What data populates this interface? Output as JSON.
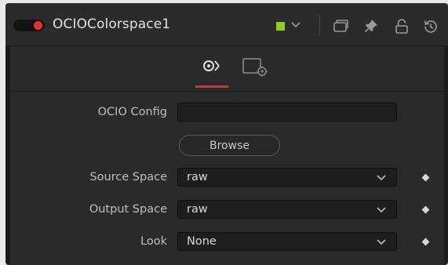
{
  "node": {
    "title": "OCIOColorspace1",
    "color": "#8fce1c"
  },
  "header_icons": [
    "toggle-icon",
    "chevron-down-icon",
    "versions-icon",
    "pin-icon",
    "lock-icon",
    "reset-icon"
  ],
  "tabs": [
    {
      "name": "controls",
      "icon": "controls-icon",
      "active": true
    },
    {
      "name": "settings",
      "icon": "settings-icon",
      "active": false
    }
  ],
  "fields": {
    "ocio_config": {
      "label": "OCIO Config",
      "value": ""
    },
    "browse": {
      "label": "Browse"
    },
    "source_space": {
      "label": "Source Space",
      "value": "raw"
    },
    "output_space": {
      "label": "Output Space",
      "value": "raw"
    },
    "look": {
      "label": "Look",
      "value": "None"
    }
  },
  "colors": {
    "accent": "#c23b38",
    "toggle_on": "#e8312c",
    "panel_bg": "#2a2a2c"
  }
}
